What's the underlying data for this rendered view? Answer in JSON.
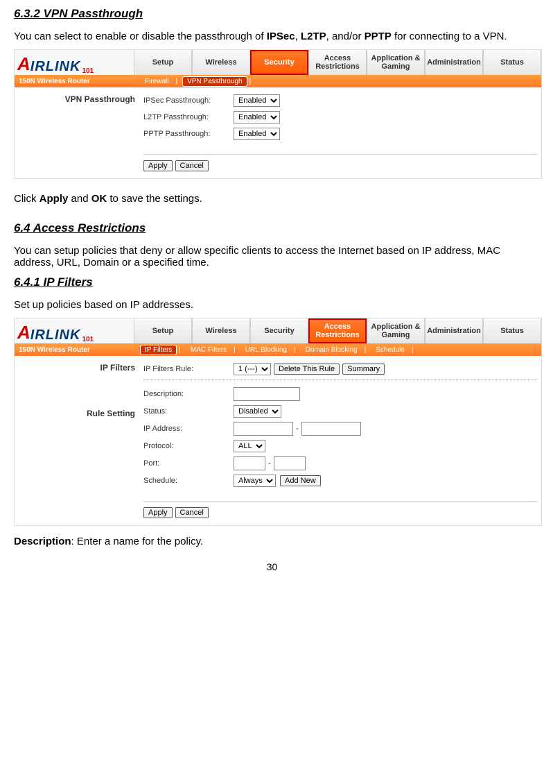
{
  "sections": {
    "s632_title": "6.3.2 VPN Passthrough",
    "s632_intro_pre": "You can select to enable or disable the passthrough of ",
    "s632_intro_mid1": ", ",
    "s632_intro_mid2": ", and/or ",
    "s632_intro_end": " for connecting to a VPN.",
    "s632_terms": {
      "ipsec": "IPSec",
      "l2tp": "L2TP",
      "pptp": "PPTP"
    },
    "click_apply_pre": "Click ",
    "click_apply_mid": " and ",
    "click_apply_end": " to save the settings.",
    "apply_word": "Apply",
    "ok_word": "OK",
    "s64_title": "6.4 Access Restrictions",
    "s64_intro": "You can setup policies that deny or allow specific clients to access the Internet based on IP address, MAC address, URL, Domain or a specified time.",
    "s641_title": "6.4.1 IP Filters",
    "s641_intro": "Set up policies based on IP addresses.",
    "desc_line_pre": "Description",
    "desc_line_end": ": Enter a name for the policy."
  },
  "router_common": {
    "logo_a": "A",
    "logo_rest": "IRLINK",
    "logo_sub": "101",
    "model": "150N Wireless Router",
    "tabs": {
      "setup": "Setup",
      "wireless": "Wireless",
      "security": "Security",
      "access": "Access Restrictions",
      "app": "Application & Gaming",
      "admin": "Administration",
      "status": "Status"
    },
    "buttons": {
      "apply": "Apply",
      "cancel": "Cancel"
    }
  },
  "vpn_panel": {
    "subtabs": {
      "firewall": "Firewall",
      "vpn": "VPN Passthrough"
    },
    "left_title": "VPN Passthrough",
    "rows": {
      "ipsec_label": "IPSec Passthrough:",
      "ipsec_value": "Enabled",
      "l2tp_label": "L2TP Passthrough:",
      "l2tp_value": "Enabled",
      "pptp_label": "PPTP Passthrough:",
      "pptp_value": "Enabled"
    }
  },
  "ip_panel": {
    "subtabs": {
      "ip": "IP Filters",
      "mac": "MAC Filters",
      "url": "URL Blocking",
      "domain": "Domain Blocking",
      "schedule": "Schedule"
    },
    "left_title": "IP Filters",
    "rule_label": "IP Filters Rule:",
    "rule_select": "1 (---)",
    "delete_btn": "Delete This Rule",
    "summary_btn": "Summary",
    "rule_setting_heading": "Rule Setting",
    "rows": {
      "description_label": "Description:",
      "status_label": "Status:",
      "status_value": "Disabled",
      "ip_label": "IP Address:",
      "dash": "-",
      "protocol_label": "Protocol:",
      "protocol_value": "ALL",
      "port_label": "Port:",
      "port_dash": "-",
      "schedule_label": "Schedule:",
      "schedule_value": "Always",
      "addnew_btn": "Add New"
    }
  },
  "page_number": "30"
}
